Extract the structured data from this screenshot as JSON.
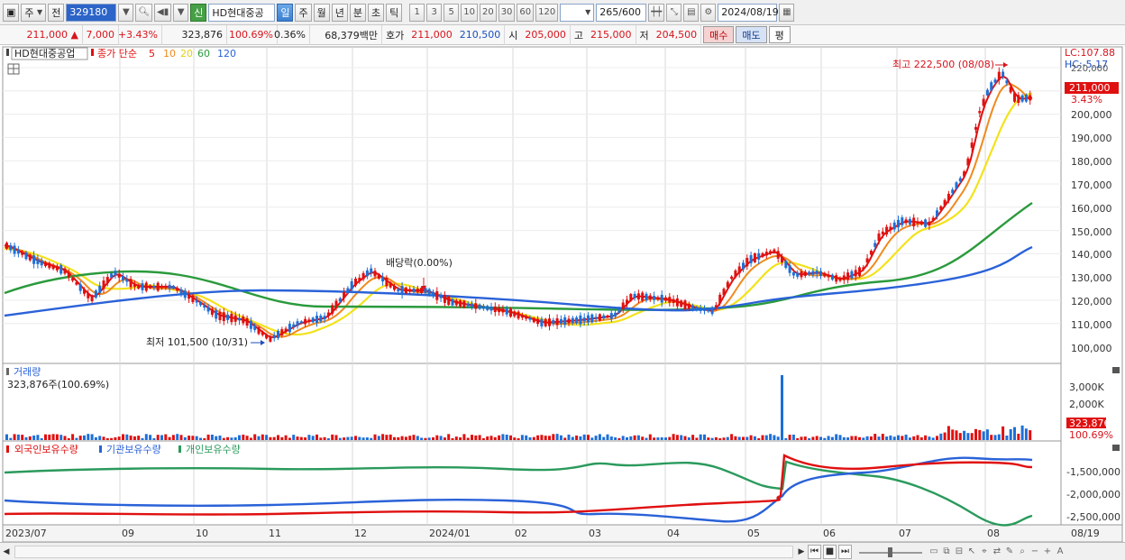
{
  "toolbar": {
    "period_selector": "주",
    "prev_label": "전",
    "stock_code": "329180",
    "new_badge": "신",
    "stock_name": "HD현대중공",
    "tf_day": "일",
    "tf_week": "주",
    "tf_month": "월",
    "tf_year": "년",
    "tf_minute": "분",
    "tf_second": "초",
    "tf_tick": "틱",
    "intervals": [
      "1",
      "3",
      "5",
      "10",
      "20",
      "30",
      "60",
      "120"
    ],
    "count": "265",
    "count_max": "/600",
    "date": "2024/08/19"
  },
  "quote": {
    "price": "211,000",
    "direction_icon": "▲",
    "change": "7,000",
    "change_pct": "+3.43%",
    "volume": "323,876",
    "volume_ratio": "100.69%",
    "turnover_pct": "0.36%",
    "amount": "68,379백만",
    "ask_label": "호가",
    "ask1": "211,000",
    "ask2": "210,500",
    "open_label": "시",
    "open": "205,000",
    "high_label": "고",
    "high": "215,000",
    "low_label": "저",
    "low": "204,500",
    "buy_label": "매수",
    "sell_label": "매도",
    "eval_label": "평"
  },
  "price_panel": {
    "legend_name": "HD현대중공업",
    "legend_prefix": "종가 단순",
    "ma_labels": [
      "5",
      "10",
      "20",
      "60",
      "120"
    ],
    "ma_colors": [
      "#e01010",
      "#f08a1e",
      "#f3e21a",
      "#2a9a3c",
      "#2a62d8"
    ],
    "lc_label": "LC:107.88",
    "hc_label": "HC:-5.17",
    "y_ticks": [
      "220,000",
      "200,000",
      "190,000",
      "180,000",
      "170,000",
      "160,000",
      "150,000",
      "140,000",
      "130,000",
      "120,000",
      "110,000",
      "100,000"
    ],
    "price_tag": "211,000",
    "price_tag_pct": "3.43%",
    "high_annotation": "최고 222,500 (08/08)",
    "low_annotation": "최저 101,500 (10/31)",
    "dividend_annotation": "배당락(0.00%)"
  },
  "volume_panel": {
    "title": "거래량",
    "value_text": "323,876주(100.69%)",
    "y_ticks": [
      "3,000K",
      "2,000K",
      "1,000K"
    ],
    "tag_value": "323,876",
    "tag_pct": "100.69%"
  },
  "holdings_panel": {
    "legend": [
      "외국인보유수량",
      "기관보유수량",
      "개인보유수량"
    ],
    "legend_colors": [
      "#e01010",
      "#2a62d8",
      "#2a9a5c"
    ],
    "y_ticks": [
      "-1,500,000",
      "-2,000,000",
      "-2,500,000"
    ]
  },
  "x_axis": {
    "labels": [
      "2023/07",
      "09",
      "10",
      "11",
      "12",
      "2024/01",
      "02",
      "03",
      "04",
      "05",
      "06",
      "07",
      "08",
      "08/19"
    ]
  },
  "colors": {
    "up": "#e01010",
    "down": "#1d6fd8",
    "grid": "#d9d9d9",
    "panel_bg": "#ffffff"
  }
}
